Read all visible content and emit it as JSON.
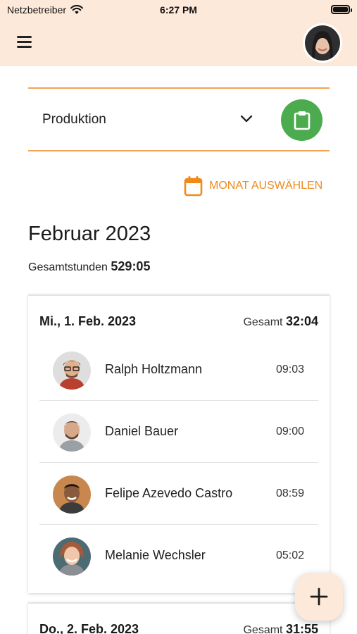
{
  "status_bar": {
    "carrier": "Netzbetreiber",
    "time": "6:27 PM"
  },
  "header": {
    "menu_icon": "hamburger-menu-icon",
    "avatar": "user-avatar"
  },
  "department": {
    "selected": "Produktion",
    "icon": "chevron-down-icon",
    "action_icon": "clipboard-icon"
  },
  "month_selector": {
    "label": "MONAT AUSWÄHLEN",
    "icon": "calendar-icon"
  },
  "summary": {
    "month": "Februar 2023",
    "total_label": "Gesamtstunden",
    "total_value": "529:05"
  },
  "days": [
    {
      "date": "Mi., 1. Feb. 2023",
      "total_label": "Gesamt",
      "total_value": "32:04",
      "entries": [
        {
          "name": "Ralph Holtzmann",
          "hours": "09:03"
        },
        {
          "name": "Daniel Bauer",
          "hours": "09:00"
        },
        {
          "name": "Felipe Azevedo  Castro",
          "hours": "08:59"
        },
        {
          "name": "Melanie Wechsler",
          "hours": "05:02"
        }
      ]
    },
    {
      "date": "Do., 2. Feb. 2023",
      "total_label": "Gesamt",
      "total_value": "31:55",
      "entries": []
    }
  ],
  "fab": {
    "icon": "plus-icon"
  },
  "colors": {
    "header_bg": "#fde9da",
    "accent": "#f08a1c",
    "green": "#4caa4f",
    "divider": "#f4a356"
  }
}
